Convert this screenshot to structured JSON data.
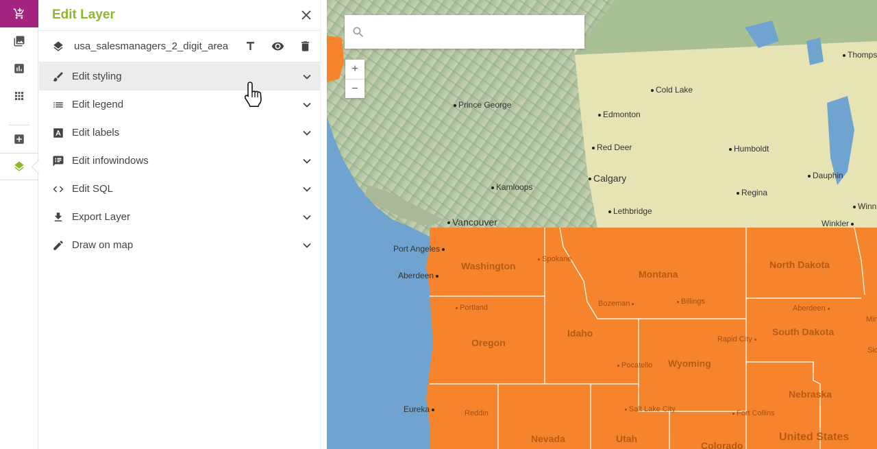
{
  "rail": {
    "items": [
      {
        "name": "cart-icon",
        "color": "#ffffff"
      },
      {
        "name": "image-icon"
      },
      {
        "name": "chart-icon"
      },
      {
        "name": "apps-icon"
      },
      {
        "name": "add-icon"
      },
      {
        "name": "layers-icon",
        "color": "#8bb82d"
      }
    ],
    "accent": "#a4237f"
  },
  "panel": {
    "title": "Edit Layer",
    "title_color": "#8bb82d",
    "layer": {
      "name": "usa_salesmanagers_2_digit_area",
      "actions": [
        "text-icon",
        "eye-icon",
        "trash-icon"
      ]
    },
    "menu": [
      {
        "label": "Edit styling",
        "icon": "brush-icon"
      },
      {
        "label": "Edit legend",
        "icon": "list-icon"
      },
      {
        "label": "Edit labels",
        "icon": "label-icon"
      },
      {
        "label": "Edit infowindows",
        "icon": "infowindow-icon"
      },
      {
        "label": "Edit SQL",
        "icon": "code-icon"
      },
      {
        "label": "Export Layer",
        "icon": "download-icon"
      },
      {
        "label": "Draw on map",
        "icon": "pencil-icon"
      }
    ]
  },
  "map": {
    "search": {
      "placeholder": "",
      "value": ""
    },
    "zoom": {
      "in": "+",
      "out": "−"
    },
    "region_color": "#f5842c",
    "canada_cities": [
      {
        "name": "Thomps"
      },
      {
        "name": "Cold Lake"
      },
      {
        "name": "Prince George"
      },
      {
        "name": "Edmonton"
      },
      {
        "name": "Red Deer"
      },
      {
        "name": "Humboldt"
      },
      {
        "name": "Calgary"
      },
      {
        "name": "Dauphin"
      },
      {
        "name": "Kamloops"
      },
      {
        "name": "Regina"
      },
      {
        "name": "Winn"
      },
      {
        "name": "Lethbridge"
      },
      {
        "name": "Vancouver"
      },
      {
        "name": "Winkler"
      },
      {
        "name": "Port Angeles"
      },
      {
        "name": "Aberdeen"
      },
      {
        "name": "Eureka"
      }
    ],
    "us_cities": [
      {
        "name": "Spokane"
      },
      {
        "name": "Bozeman"
      },
      {
        "name": "Billings"
      },
      {
        "name": "Portland"
      },
      {
        "name": "Aberdeen"
      },
      {
        "name": "Rapid City"
      },
      {
        "name": "Pocatello"
      },
      {
        "name": "Salt Lake City"
      },
      {
        "name": "Fort Collins"
      },
      {
        "name": "Reddin"
      },
      {
        "name": "Min"
      },
      {
        "name": "Sio"
      }
    ],
    "states": [
      {
        "name": "Washington"
      },
      {
        "name": "Montana"
      },
      {
        "name": "North Dakota"
      },
      {
        "name": "Oregon"
      },
      {
        "name": "Idaho"
      },
      {
        "name": "South Dakota"
      },
      {
        "name": "Wyoming"
      },
      {
        "name": "Nebraska"
      },
      {
        "name": "Nevada"
      },
      {
        "name": "Utah"
      },
      {
        "name": "Colorado"
      },
      {
        "name": "United States"
      }
    ]
  }
}
